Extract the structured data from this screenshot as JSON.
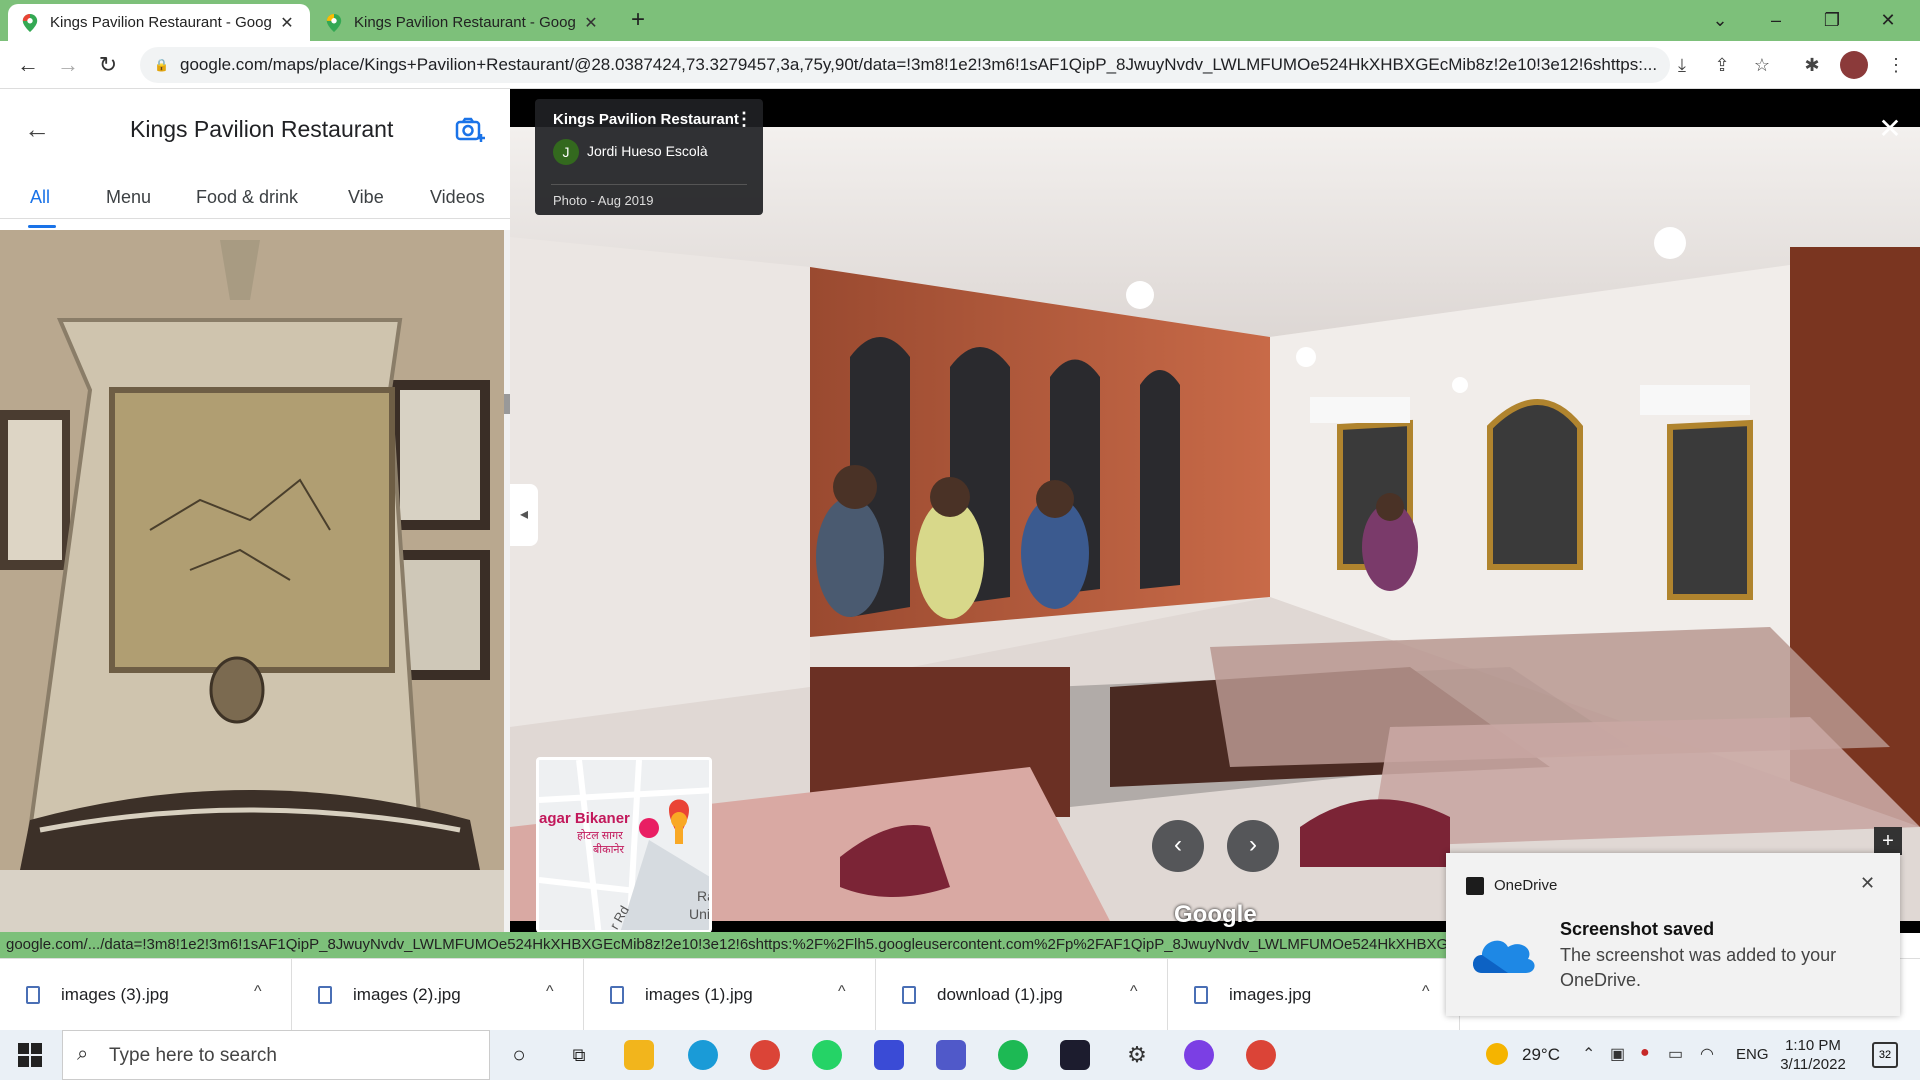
{
  "browser": {
    "tabs": [
      {
        "title": "Kings Pavilion Restaurant - Goog",
        "active": true
      },
      {
        "title": "Kings Pavilion Restaurant - Goog",
        "active": false
      }
    ],
    "new_tab_symbol": "+",
    "url": "google.com/maps/place/Kings+Pavilion+Restaurant/@28.0387424,73.3279457,3a,75y,90t/data=!3m8!1e2!3m6!1sAF1QipP_8JwuyNvdv_LWLMFUMOe524HkXHBXGEcMib8z!2e10!3e12!6shttps:...",
    "status_url": "google.com/.../data=!3m8!1e2!3m6!1sAF1QipP_8JwuyNvdv_LWLMFUMOe524HkXHBXGEcMib8z!2e10!3e12!6shttps:%2F%2Flh5.googleusercontent.com%2Fp%2FAF1QipP_8JwuyNvdv_LWLMFUMOe524HkXHBXGEcMib8z"
  },
  "left_panel": {
    "title": "Kings Pavilion Restaurant",
    "tabs": [
      "All",
      "Menu",
      "Food & drink",
      "Vibe",
      "Videos"
    ]
  },
  "viewer": {
    "info": {
      "place": "Kings Pavilion Restaurant",
      "author_initial": "J",
      "author": "Jordi Hueso Escolà",
      "date": "Photo - Aug 2019"
    },
    "minimap": {
      "label1": "agar Bikaner",
      "label2": "होटल सागर",
      "label3": "बीकानेर",
      "label4": "Ra",
      "label5": "Uni",
      "label6": "r Rd"
    },
    "watermark": "Google"
  },
  "downloads": [
    "images (3).jpg",
    "images (2).jpg",
    "images (1).jpg",
    "download (1).jpg",
    "images.jpg"
  ],
  "toast": {
    "app": "OneDrive",
    "title": "Screenshot saved",
    "body": "The screenshot was added to your OneDrive."
  },
  "taskbar": {
    "search_placeholder": "Type here to search",
    "temperature": "29°C",
    "language": "ENG",
    "time": "1:10 PM",
    "date": "3/11/2022",
    "notification_count": "32"
  },
  "colors": {
    "accent": "#1a73e8",
    "tabstrip": "#7dc07a"
  }
}
